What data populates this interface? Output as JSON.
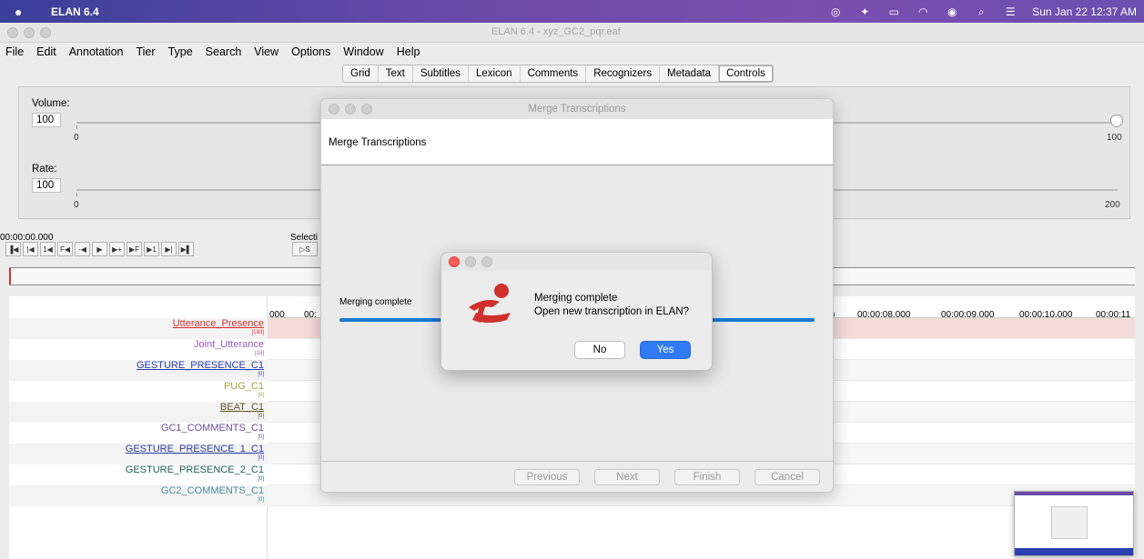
{
  "mac_menu": {
    "app_name": "ELAN 6.4",
    "clock": "Sun Jan 22  12:37 AM"
  },
  "window": {
    "title": "ELAN 6.4 - xyz_GC2_pqr.eaf"
  },
  "menu": [
    "File",
    "Edit",
    "Annotation",
    "Tier",
    "Type",
    "Search",
    "View",
    "Options",
    "Window",
    "Help"
  ],
  "tabs": [
    {
      "label": "Grid"
    },
    {
      "label": "Text"
    },
    {
      "label": "Subtitles"
    },
    {
      "label": "Lexicon"
    },
    {
      "label": "Comments"
    },
    {
      "label": "Recognizers"
    },
    {
      "label": "Metadata"
    },
    {
      "label": "Controls",
      "active": true
    }
  ],
  "controls": {
    "volume_label": "Volume:",
    "volume_value": "100",
    "volume_min": "0",
    "volume_max": "100",
    "rate_label": "Rate:",
    "rate_value": "100",
    "rate_min": "0",
    "rate_max": "200"
  },
  "player": {
    "time": "00:00:00.000",
    "selection_label": "Selecti",
    "selection_btn": "▷S"
  },
  "ruler": {
    "t0": "000",
    "t0b": "00:",
    "ticks": [
      "00:00:08.000",
      "00:00:09.000",
      "00:00:10.000",
      "00:00:11"
    ],
    "t_left": ")"
  },
  "tiers": [
    {
      "name": "Utterance_Presence",
      "count": "[183]",
      "color": "#d0312d",
      "underline": true
    },
    {
      "name": "Joint_Utterance",
      "count": "[18]",
      "color": "#9b59b6"
    },
    {
      "name": "GESTURE_PRESENCE_C1",
      "count": "[0]",
      "color": "#2a3fb0",
      "underline": true
    },
    {
      "name": "PUG_C1",
      "count": "[0]",
      "color": "#a7a24a"
    },
    {
      "name": "BEAT_C1",
      "count": "[0]",
      "color": "#5d5320",
      "underline": true
    },
    {
      "name": "GC1_COMMENTS_C1",
      "count": "[0]",
      "color": "#6e4a9e"
    },
    {
      "name": "GESTURE_PRESENCE_1_C1",
      "count": "[0]",
      "color": "#2b3a9e",
      "underline": true
    },
    {
      "name": "GESTURE_PRESENCE_2_C1",
      "count": "[0]",
      "color": "#1f5c5a"
    },
    {
      "name": "GC2_COMMENTS_C1",
      "count": "[0]",
      "color": "#4e8fa0"
    }
  ],
  "merge_dialog": {
    "title": "Merge Transcriptions",
    "heading": "Merge Transcriptions",
    "status": "Merging complete",
    "progress": 1.0,
    "buttons": {
      "previous": "Previous",
      "next": "Next",
      "finish": "Finish",
      "cancel": "Cancel"
    }
  },
  "confirm_dialog": {
    "line1": "Merging complete",
    "line2": "Open new transcription in ELAN?",
    "no": "No",
    "yes": "Yes"
  },
  "colors": {
    "accent": "#1a78d6",
    "yes_button": "#2f7bf6",
    "selected_lane": "#f5dada"
  }
}
